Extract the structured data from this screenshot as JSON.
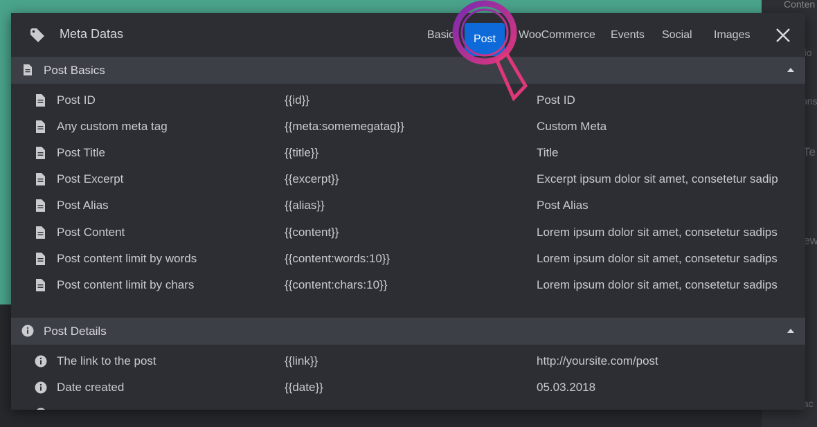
{
  "background": {
    "right_panel_text": "Conten",
    "fragments": [
      "atio",
      "ons",
      "Te",
      "ew",
      "ac"
    ]
  },
  "modal": {
    "title": "Meta Datas",
    "tabs": [
      {
        "label": "Basic",
        "active": false
      },
      {
        "label": "Post",
        "active": true
      },
      {
        "label": "WooCommerce",
        "active": false
      },
      {
        "label": "Events",
        "active": false
      },
      {
        "label": "Social",
        "active": false
      },
      {
        "label": "Images",
        "active": false
      }
    ],
    "close_icon": "close-icon",
    "sections": [
      {
        "title": "Post Basics",
        "icon": "document-icon",
        "rows": [
          {
            "name": "Post ID",
            "tag": "{{id}}",
            "example": "Post ID"
          },
          {
            "name": "Any custom meta tag",
            "tag": "{{meta:somemegatag}}",
            "example": "Custom Meta"
          },
          {
            "name": "Post Title",
            "tag": "{{title}}",
            "example": "Title"
          },
          {
            "name": "Post Excerpt",
            "tag": "{{excerpt}}",
            "example": "Excerpt ipsum dolor sit amet, consetetur sadip"
          },
          {
            "name": "Post Alias",
            "tag": "{{alias}}",
            "example": "Post Alias"
          },
          {
            "name": "Post Content",
            "tag": "{{content}}",
            "example": "Lorem ipsum dolor sit amet, consetetur sadips"
          },
          {
            "name": "Post content limit by words",
            "tag": "{{content:words:10}}",
            "example": "Lorem ipsum dolor sit amet, consetetur sadips"
          },
          {
            "name": "Post content limit by chars",
            "tag": "{{content:chars:10}}",
            "example": "Lorem ipsum dolor sit amet, consetetur sadips"
          }
        ]
      },
      {
        "title": "Post Details",
        "icon": "info-icon",
        "rows": [
          {
            "name": "The link to the post",
            "tag": "{{link}}",
            "example": "http://yoursite.com/post"
          },
          {
            "name": "Date created",
            "tag": "{{date}}",
            "example": "05.03.2018"
          }
        ]
      }
    ]
  },
  "colors": {
    "accent": "#0d6ad8",
    "background_teal": "#4aa38b",
    "magnifier_ring": "#8e2aa8",
    "magnifier_handle": "#e0377a"
  }
}
